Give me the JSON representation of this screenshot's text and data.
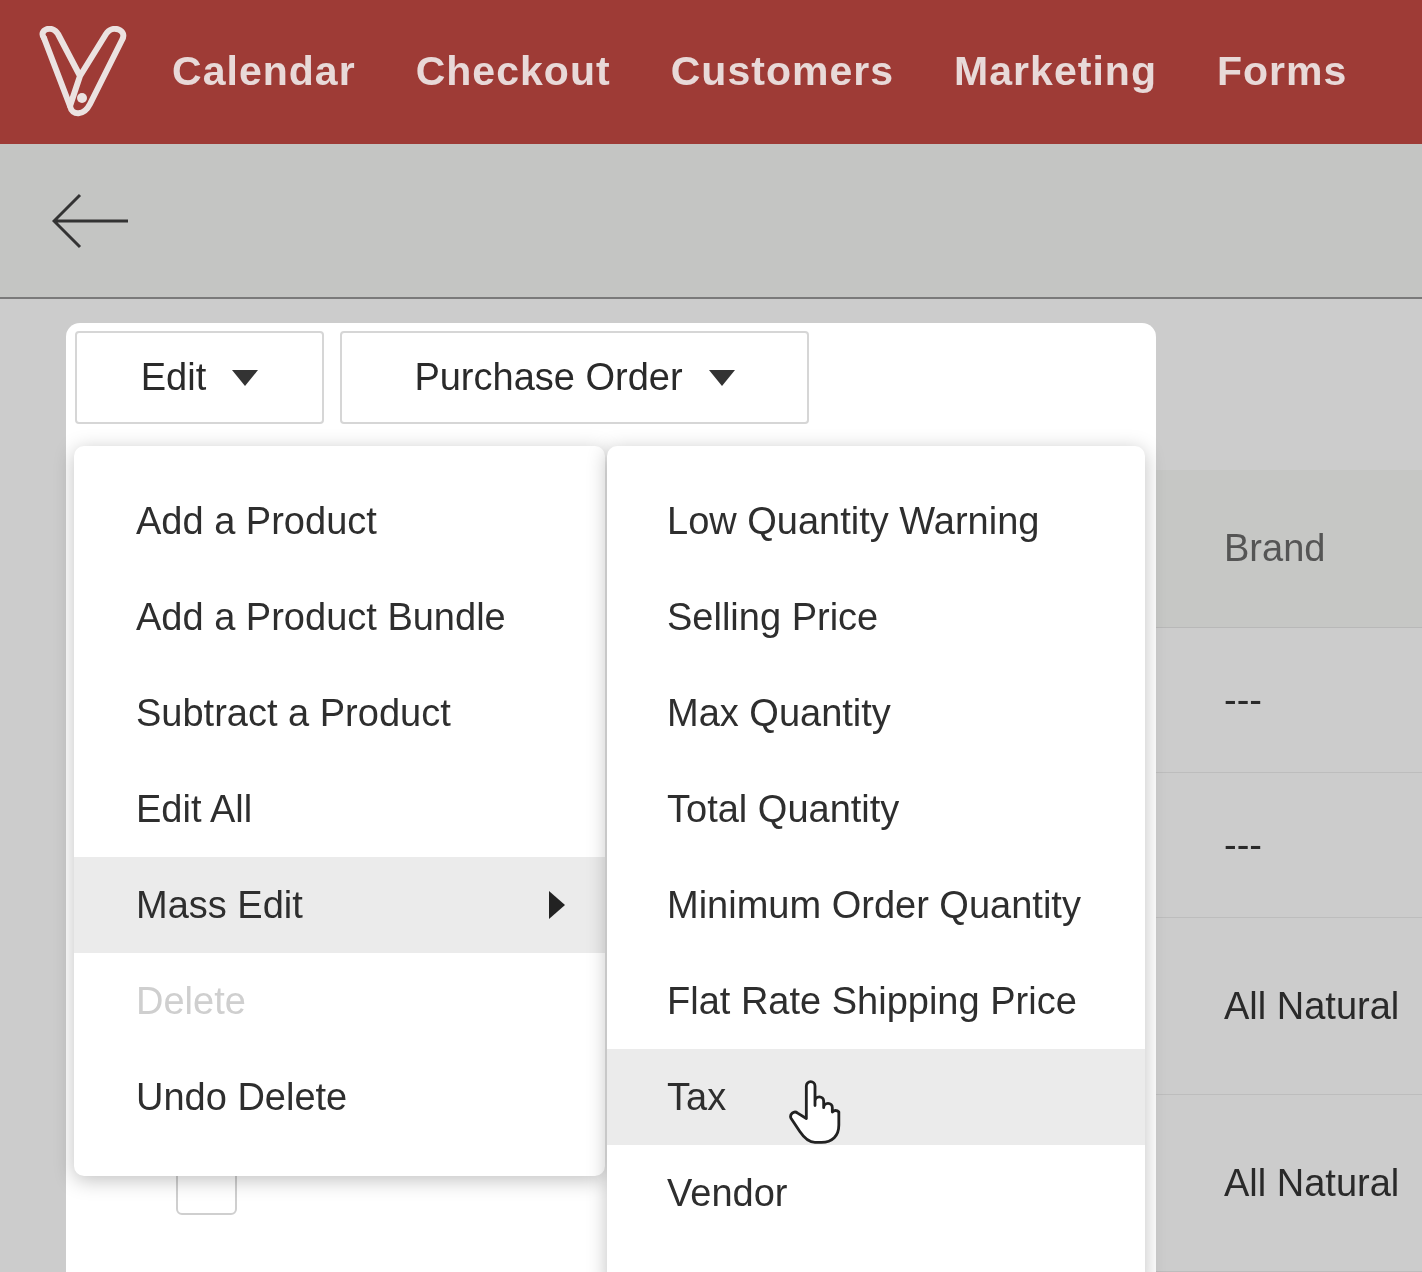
{
  "nav": {
    "items": [
      "Calendar",
      "Checkout",
      "Customers",
      "Marketing",
      "Forms"
    ]
  },
  "toolbar": {
    "buttons": [
      {
        "label": "Edit"
      },
      {
        "label": "Purchase Order"
      }
    ]
  },
  "edit_menu": {
    "items": [
      {
        "label": "Add a Product",
        "selected": false,
        "disabled": false,
        "has_submenu": false
      },
      {
        "label": "Add a Product Bundle",
        "selected": false,
        "disabled": false,
        "has_submenu": false
      },
      {
        "label": "Subtract a Product",
        "selected": false,
        "disabled": false,
        "has_submenu": false
      },
      {
        "label": "Edit All",
        "selected": false,
        "disabled": false,
        "has_submenu": false
      },
      {
        "label": "Mass Edit",
        "selected": true,
        "disabled": false,
        "has_submenu": true
      },
      {
        "label": "Delete",
        "selected": false,
        "disabled": true,
        "has_submenu": false
      },
      {
        "label": "Undo Delete",
        "selected": false,
        "disabled": false,
        "has_submenu": false
      }
    ]
  },
  "mass_edit_submenu": {
    "items": [
      {
        "label": "Low Quantity Warning",
        "selected": false
      },
      {
        "label": "Selling Price",
        "selected": false
      },
      {
        "label": "Max Quantity",
        "selected": false
      },
      {
        "label": "Total Quantity",
        "selected": false
      },
      {
        "label": "Minimum Order Quantity",
        "selected": false
      },
      {
        "label": "Flat Rate Shipping Price",
        "selected": false
      },
      {
        "label": "Tax",
        "selected": true
      },
      {
        "label": "Vendor",
        "selected": false
      }
    ]
  },
  "table": {
    "columns": [
      "Brand"
    ],
    "rows": [
      {
        "brand": "---"
      },
      {
        "brand": "---"
      },
      {
        "brand": "All Natural"
      },
      {
        "checked": false,
        "brand": "All Natural"
      }
    ]
  }
}
